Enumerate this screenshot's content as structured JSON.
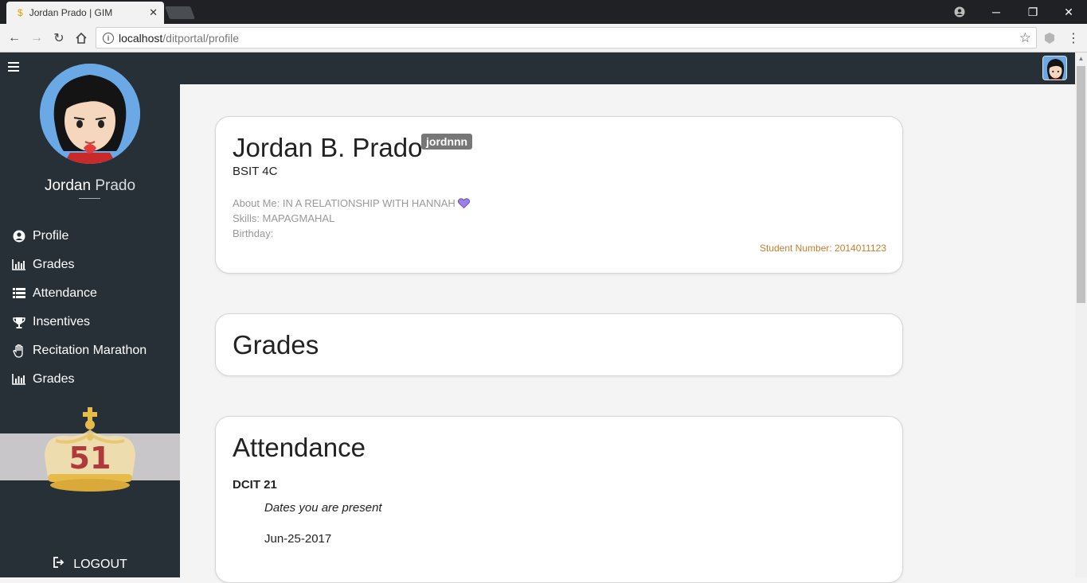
{
  "browser": {
    "tab_title": "Jordan Prado | GIM",
    "url_host": "localhost",
    "url_path": "/ditportal/profile"
  },
  "sidebar": {
    "first_name": "Jordan",
    "last_name": " Prado",
    "items": [
      {
        "label": "Profile",
        "icon": "user-circle-icon"
      },
      {
        "label": "Grades",
        "icon": "bar-chart-icon"
      },
      {
        "label": "Attendance",
        "icon": "list-icon"
      },
      {
        "label": "Insentives",
        "icon": "trophy-icon"
      },
      {
        "label": "Recitation Marathon",
        "icon": "hand-icon"
      },
      {
        "label": "Grades",
        "icon": "bar-chart-icon"
      }
    ],
    "rank": "51",
    "logout_label": "LOGOUT"
  },
  "profile": {
    "full_name": "Jordan B. Prado",
    "username": "jordnnn",
    "course": "BSIT 4C",
    "about": "About Me: IN A RELATIONSHIP WITH HANNAH",
    "skills": "Skills: MAPAGMAHAL",
    "birthday": "Birthday:",
    "student_number": "Student Number: 2014011123"
  },
  "grades": {
    "heading": "Grades"
  },
  "attendance": {
    "heading": "Attendance",
    "subject": "DCIT 21",
    "dates_label": "Dates you are present",
    "dates": [
      "Jun-25-2017"
    ]
  },
  "colors": {
    "sidebar_bg": "#273036",
    "avatar_bg": "#6aa9e6",
    "student_number": "#c57d2b",
    "rank_number": "#b03a3a"
  }
}
